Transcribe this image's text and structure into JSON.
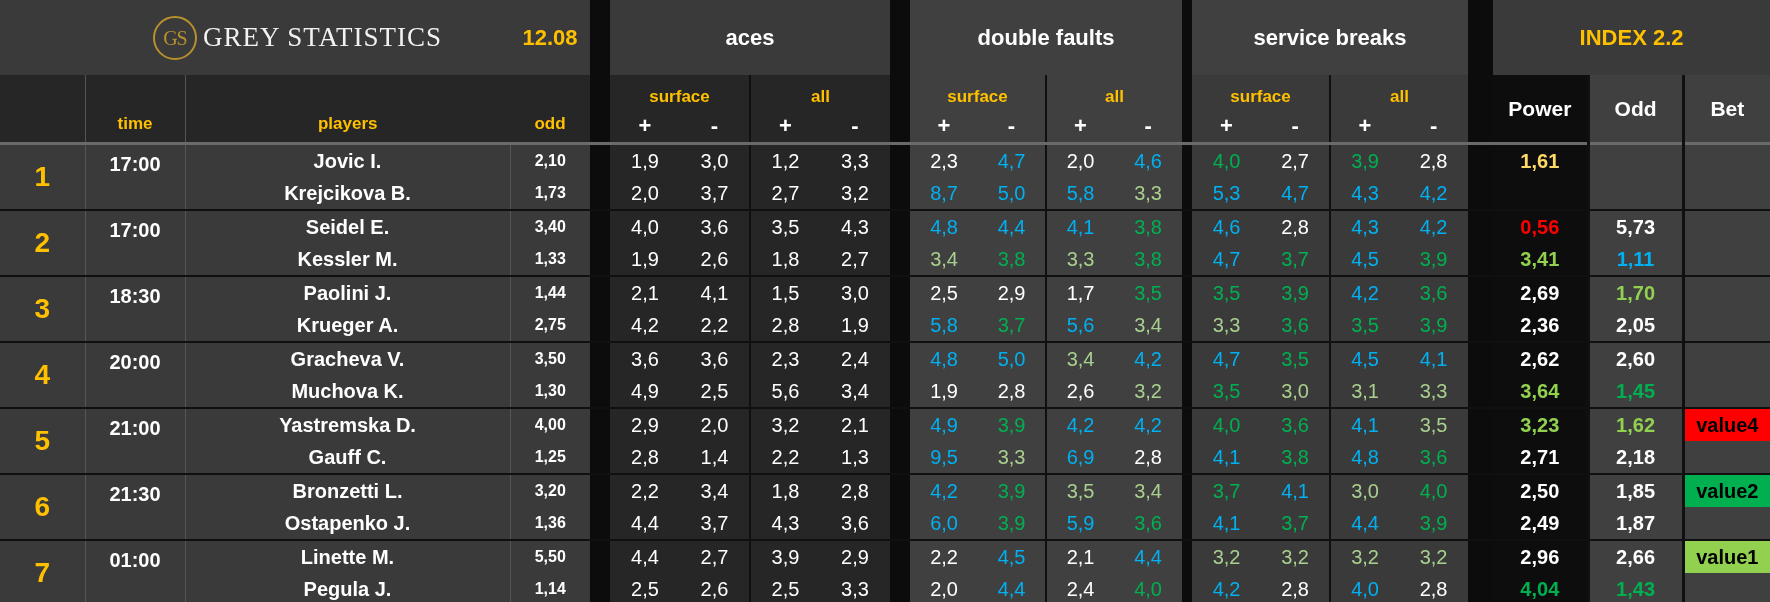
{
  "header": {
    "logo_monogram": "GS",
    "logo_text": "GREY STATISTICS",
    "date": "12.08",
    "index_title": "INDEX 2.2"
  },
  "columns": {
    "time": "time",
    "players": "players",
    "odd": "odd",
    "power": "Power",
    "index_odd": "Odd",
    "bet": "Bet"
  },
  "stat_groups": [
    {
      "title": "aces",
      "subgroups": [
        {
          "label": "surface",
          "signs": [
            "+",
            "-"
          ]
        },
        {
          "label": "all",
          "signs": [
            "+",
            "-"
          ]
        }
      ]
    },
    {
      "title": "double faults",
      "subgroups": [
        {
          "label": "surface",
          "signs": [
            "+",
            "-"
          ]
        },
        {
          "label": "all",
          "signs": [
            "+",
            "-"
          ]
        }
      ]
    },
    {
      "title": "service breaks",
      "subgroups": [
        {
          "label": "surface",
          "signs": [
            "+",
            "-"
          ]
        },
        {
          "label": "all",
          "signs": [
            "+",
            "-"
          ]
        }
      ]
    }
  ],
  "matches": [
    {
      "number": "1",
      "time": "17:00",
      "players": [
        {
          "name": "Jovic I.",
          "odd": "2,10",
          "stats": [
            [
              {
                "value": "1,9"
              },
              {
                "value": "3,0"
              },
              {
                "value": "1,2"
              },
              {
                "value": "3,3"
              }
            ],
            [
              {
                "value": "2,3"
              },
              {
                "value": "4,7",
                "color": "#00b0f0"
              },
              {
                "value": "2,0"
              },
              {
                "value": "4,6",
                "color": "#00b0f0"
              }
            ],
            [
              {
                "value": "4,0",
                "color": "#00b050"
              },
              {
                "value": "2,7"
              },
              {
                "value": "3,9",
                "color": "#00b050"
              },
              {
                "value": "2,8"
              }
            ]
          ],
          "power": {
            "value": "1,61",
            "color": "#ffd966"
          }
        },
        {
          "name": "Krejcikova B.",
          "odd": "1,73",
          "stats": [
            [
              {
                "value": "2,0"
              },
              {
                "value": "3,7"
              },
              {
                "value": "2,7"
              },
              {
                "value": "3,2"
              }
            ],
            [
              {
                "value": "8,7",
                "color": "#00b0f0"
              },
              {
                "value": "5,0",
                "color": "#00b0f0"
              },
              {
                "value": "5,8",
                "color": "#00b0f0"
              },
              {
                "value": "3,3",
                "color": "#a9d08e"
              }
            ],
            [
              {
                "value": "5,3",
                "color": "#00b0f0"
              },
              {
                "value": "4,7",
                "color": "#00b0f0"
              },
              {
                "value": "4,3",
                "color": "#00b0f0"
              },
              {
                "value": "4,2",
                "color": "#00b0f0"
              }
            ]
          ]
        }
      ]
    },
    {
      "number": "2",
      "time": "17:00",
      "players": [
        {
          "name": "Seidel E.",
          "odd": "3,40",
          "stats": [
            [
              {
                "value": "4,0"
              },
              {
                "value": "3,6"
              },
              {
                "value": "3,5"
              },
              {
                "value": "4,3"
              }
            ],
            [
              {
                "value": "4,8",
                "color": "#00b0f0"
              },
              {
                "value": "4,4",
                "color": "#00b0f0"
              },
              {
                "value": "4,1",
                "color": "#00b0f0"
              },
              {
                "value": "3,8",
                "color": "#00b050"
              }
            ],
            [
              {
                "value": "4,6",
                "color": "#00b0f0"
              },
              {
                "value": "2,8"
              },
              {
                "value": "4,3",
                "color": "#00b0f0"
              },
              {
                "value": "4,2",
                "color": "#00b0f0"
              }
            ]
          ],
          "power": {
            "value": "0,56",
            "color": "#ff0000"
          },
          "index_odd": {
            "value": "5,73"
          }
        },
        {
          "name": "Kessler M.",
          "odd": "1,33",
          "stats": [
            [
              {
                "value": "1,9"
              },
              {
                "value": "2,6"
              },
              {
                "value": "1,8"
              },
              {
                "value": "2,7"
              }
            ],
            [
              {
                "value": "3,4",
                "color": "#a9d08e"
              },
              {
                "value": "3,8",
                "color": "#00b050"
              },
              {
                "value": "3,3",
                "color": "#a9d08e"
              },
              {
                "value": "3,8",
                "color": "#00b050"
              }
            ],
            [
              {
                "value": "4,7",
                "color": "#00b0f0"
              },
              {
                "value": "3,7",
                "color": "#00b050"
              },
              {
                "value": "4,5",
                "color": "#00b0f0"
              },
              {
                "value": "3,9",
                "color": "#00b050"
              }
            ]
          ],
          "power": {
            "value": "3,41",
            "color": "#92d050"
          },
          "index_odd": {
            "value": "1,11",
            "color": "#00b0f0"
          }
        }
      ]
    },
    {
      "number": "3",
      "time": "18:30",
      "players": [
        {
          "name": "Paolini J.",
          "odd": "1,44",
          "stats": [
            [
              {
                "value": "2,1"
              },
              {
                "value": "4,1"
              },
              {
                "value": "1,5"
              },
              {
                "value": "3,0"
              }
            ],
            [
              {
                "value": "2,5"
              },
              {
                "value": "2,9"
              },
              {
                "value": "1,7"
              },
              {
                "value": "3,5",
                "color": "#00b050"
              }
            ],
            [
              {
                "value": "3,5",
                "color": "#00b050"
              },
              {
                "value": "3,9",
                "color": "#00b050"
              },
              {
                "value": "4,2",
                "color": "#00b0f0"
              },
              {
                "value": "3,6",
                "color": "#00b050"
              }
            ]
          ],
          "power": {
            "value": "2,69"
          },
          "index_odd": {
            "value": "1,70",
            "color": "#92d050"
          }
        },
        {
          "name": "Krueger A.",
          "odd": "2,75",
          "stats": [
            [
              {
                "value": "4,2"
              },
              {
                "value": "2,2"
              },
              {
                "value": "2,8"
              },
              {
                "value": "1,9"
              }
            ],
            [
              {
                "value": "5,8",
                "color": "#00b0f0"
              },
              {
                "value": "3,7",
                "color": "#00b050"
              },
              {
                "value": "5,6",
                "color": "#00b0f0"
              },
              {
                "value": "3,4",
                "color": "#a9d08e"
              }
            ],
            [
              {
                "value": "3,3",
                "color": "#a9d08e"
              },
              {
                "value": "3,6",
                "color": "#00b050"
              },
              {
                "value": "3,5",
                "color": "#00b050"
              },
              {
                "value": "3,9",
                "color": "#00b050"
              }
            ]
          ],
          "power": {
            "value": "2,36"
          },
          "index_odd": {
            "value": "2,05"
          }
        }
      ]
    },
    {
      "number": "4",
      "time": "20:00",
      "players": [
        {
          "name": "Gracheva V.",
          "odd": "3,50",
          "stats": [
            [
              {
                "value": "3,6"
              },
              {
                "value": "3,6"
              },
              {
                "value": "2,3"
              },
              {
                "value": "2,4"
              }
            ],
            [
              {
                "value": "4,8",
                "color": "#00b0f0"
              },
              {
                "value": "5,0",
                "color": "#00b0f0"
              },
              {
                "value": "3,4",
                "color": "#a9d08e"
              },
              {
                "value": "4,2",
                "color": "#00b0f0"
              }
            ],
            [
              {
                "value": "4,7",
                "color": "#00b0f0"
              },
              {
                "value": "3,5",
                "color": "#00b050"
              },
              {
                "value": "4,5",
                "color": "#00b0f0"
              },
              {
                "value": "4,1",
                "color": "#00b0f0"
              }
            ]
          ],
          "power": {
            "value": "2,62"
          },
          "index_odd": {
            "value": "2,60"
          }
        },
        {
          "name": "Muchova K.",
          "odd": "1,30",
          "stats": [
            [
              {
                "value": "4,9"
              },
              {
                "value": "2,5"
              },
              {
                "value": "5,6"
              },
              {
                "value": "3,4"
              }
            ],
            [
              {
                "value": "1,9"
              },
              {
                "value": "2,8"
              },
              {
                "value": "2,6"
              },
              {
                "value": "3,2",
                "color": "#a9d08e"
              }
            ],
            [
              {
                "value": "3,5",
                "color": "#00b050"
              },
              {
                "value": "3,0",
                "color": "#a9d08e"
              },
              {
                "value": "3,1",
                "color": "#a9d08e"
              },
              {
                "value": "3,3",
                "color": "#a9d08e"
              }
            ]
          ],
          "power": {
            "value": "3,64",
            "color": "#92d050"
          },
          "index_odd": {
            "value": "1,45",
            "color": "#00b050"
          }
        }
      ]
    },
    {
      "number": "5",
      "time": "21:00",
      "players": [
        {
          "name": "Yastremska D.",
          "odd": "4,00",
          "stats": [
            [
              {
                "value": "2,9"
              },
              {
                "value": "2,0"
              },
              {
                "value": "3,2"
              },
              {
                "value": "2,1"
              }
            ],
            [
              {
                "value": "4,9",
                "color": "#00b0f0"
              },
              {
                "value": "3,9",
                "color": "#00b050"
              },
              {
                "value": "4,2",
                "color": "#00b0f0"
              },
              {
                "value": "4,2",
                "color": "#00b0f0"
              }
            ],
            [
              {
                "value": "4,0",
                "color": "#00b050"
              },
              {
                "value": "3,6",
                "color": "#00b050"
              },
              {
                "value": "4,1",
                "color": "#00b0f0"
              },
              {
                "value": "3,5",
                "color": "#a9d08e"
              }
            ]
          ],
          "power": {
            "value": "3,23",
            "color": "#92d050"
          },
          "index_odd": {
            "value": "1,62",
            "color": "#92d050"
          },
          "bet": {
            "label": "value4",
            "color": "#ff0000"
          }
        },
        {
          "name": "Gauff C.",
          "odd": "1,25",
          "stats": [
            [
              {
                "value": "2,8"
              },
              {
                "value": "1,4"
              },
              {
                "value": "2,2"
              },
              {
                "value": "1,3"
              }
            ],
            [
              {
                "value": "9,5",
                "color": "#00b0f0"
              },
              {
                "value": "3,3",
                "color": "#a9d08e"
              },
              {
                "value": "6,9",
                "color": "#00b0f0"
              },
              {
                "value": "2,8"
              }
            ],
            [
              {
                "value": "4,1",
                "color": "#00b0f0"
              },
              {
                "value": "3,8",
                "color": "#00b050"
              },
              {
                "value": "4,8",
                "color": "#00b0f0"
              },
              {
                "value": "3,6",
                "color": "#00b050"
              }
            ]
          ],
          "power": {
            "value": "2,71"
          },
          "index_odd": {
            "value": "2,18"
          }
        }
      ]
    },
    {
      "number": "6",
      "time": "21:30",
      "players": [
        {
          "name": "Bronzetti L.",
          "odd": "3,20",
          "stats": [
            [
              {
                "value": "2,2"
              },
              {
                "value": "3,4"
              },
              {
                "value": "1,8"
              },
              {
                "value": "2,8"
              }
            ],
            [
              {
                "value": "4,2",
                "color": "#00b0f0"
              },
              {
                "value": "3,9",
                "color": "#00b050"
              },
              {
                "value": "3,5",
                "color": "#a9d08e"
              },
              {
                "value": "3,4",
                "color": "#a9d08e"
              }
            ],
            [
              {
                "value": "3,7",
                "color": "#00b050"
              },
              {
                "value": "4,1",
                "color": "#00b0f0"
              },
              {
                "value": "3,0",
                "color": "#a9d08e"
              },
              {
                "value": "4,0",
                "color": "#00b050"
              }
            ]
          ],
          "power": {
            "value": "2,50"
          },
          "index_odd": {
            "value": "1,85"
          },
          "bet": {
            "label": "value2",
            "color": "#00b050"
          }
        },
        {
          "name": "Ostapenko J.",
          "odd": "1,36",
          "stats": [
            [
              {
                "value": "4,4"
              },
              {
                "value": "3,7"
              },
              {
                "value": "4,3"
              },
              {
                "value": "3,6"
              }
            ],
            [
              {
                "value": "6,0",
                "color": "#00b0f0"
              },
              {
                "value": "3,9",
                "color": "#00b050"
              },
              {
                "value": "5,9",
                "color": "#00b0f0"
              },
              {
                "value": "3,6",
                "color": "#00b050"
              }
            ],
            [
              {
                "value": "4,1",
                "color": "#00b0f0"
              },
              {
                "value": "3,7",
                "color": "#00b050"
              },
              {
                "value": "4,4",
                "color": "#00b0f0"
              },
              {
                "value": "3,9",
                "color": "#00b050"
              }
            ]
          ],
          "power": {
            "value": "2,49"
          },
          "index_odd": {
            "value": "1,87"
          }
        }
      ]
    },
    {
      "number": "7",
      "time": "01:00",
      "players": [
        {
          "name": "Linette M.",
          "odd": "5,50",
          "stats": [
            [
              {
                "value": "4,4"
              },
              {
                "value": "2,7"
              },
              {
                "value": "3,9"
              },
              {
                "value": "2,9"
              }
            ],
            [
              {
                "value": "2,2"
              },
              {
                "value": "4,5",
                "color": "#00b0f0"
              },
              {
                "value": "2,1"
              },
              {
                "value": "4,4",
                "color": "#00b0f0"
              }
            ],
            [
              {
                "value": "3,2",
                "color": "#a9d08e"
              },
              {
                "value": "3,2",
                "color": "#a9d08e"
              },
              {
                "value": "3,2",
                "color": "#a9d08e"
              },
              {
                "value": "3,2",
                "color": "#a9d08e"
              }
            ]
          ],
          "power": {
            "value": "2,96"
          },
          "index_odd": {
            "value": "2,66"
          },
          "bet": {
            "label": "value1",
            "color": "#92d050"
          }
        },
        {
          "name": "Pegula J.",
          "odd": "1,14",
          "stats": [
            [
              {
                "value": "2,5"
              },
              {
                "value": "2,6"
              },
              {
                "value": "2,5"
              },
              {
                "value": "3,3"
              }
            ],
            [
              {
                "value": "2,0"
              },
              {
                "value": "4,4",
                "color": "#00b0f0"
              },
              {
                "value": "2,4"
              },
              {
                "value": "4,0",
                "color": "#00b050"
              }
            ],
            [
              {
                "value": "4,2",
                "color": "#00b0f0"
              },
              {
                "value": "2,8"
              },
              {
                "value": "4,0",
                "color": "#00b0f0"
              },
              {
                "value": "2,8"
              }
            ]
          ],
          "power": {
            "value": "4,04",
            "color": "#00b050"
          },
          "index_odd": {
            "value": "1,43",
            "color": "#00b050"
          }
        }
      ]
    }
  ]
}
